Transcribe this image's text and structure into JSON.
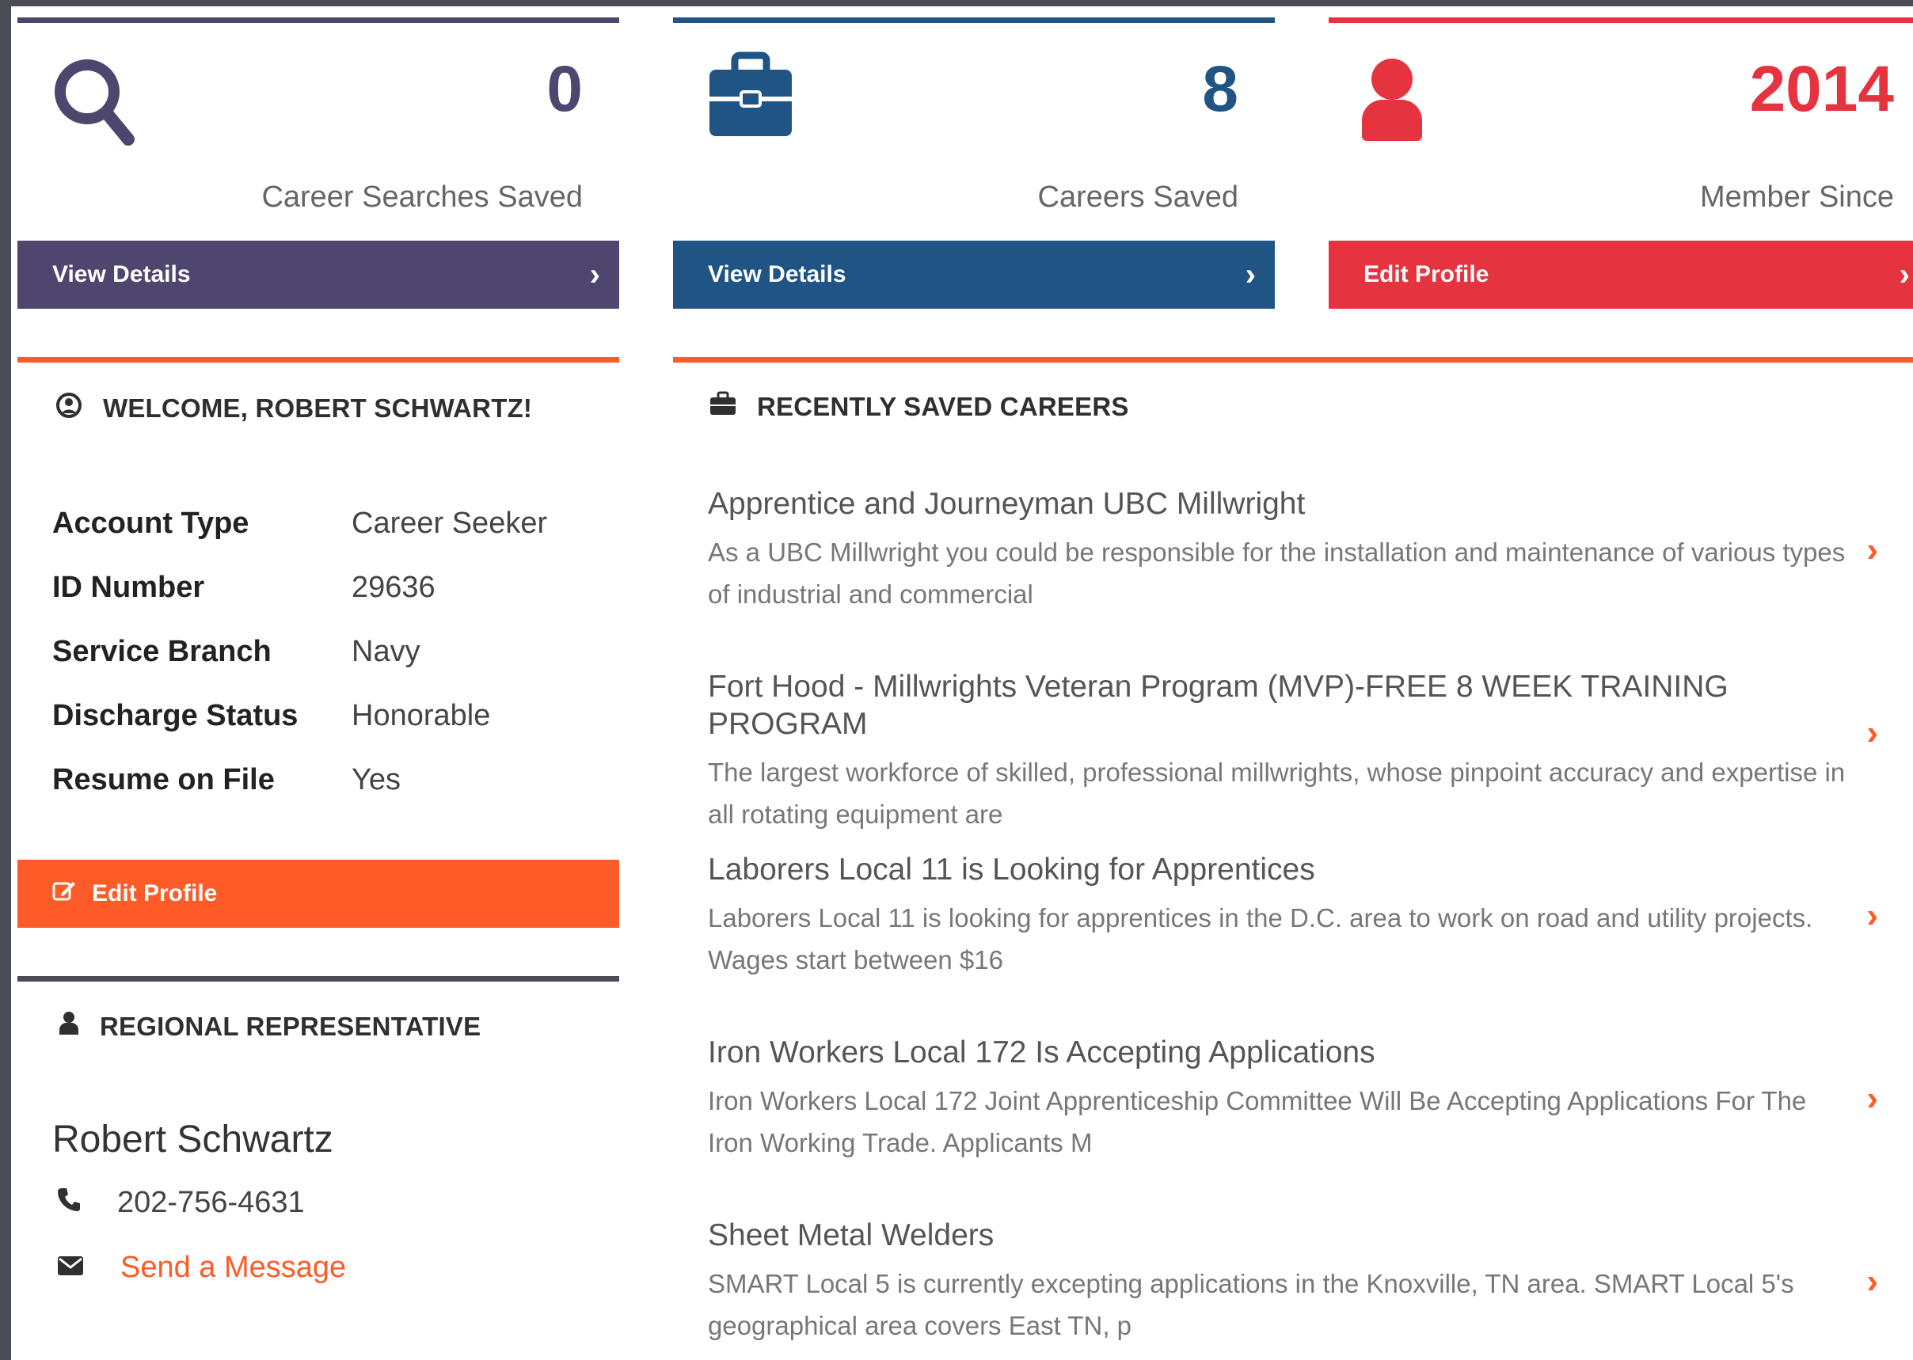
{
  "colors": {
    "purple": "#4f4670",
    "blue": "#205485",
    "red": "#e5333f",
    "orange": "#fd5b27",
    "dark_line": "#4a4d55"
  },
  "stats": [
    {
      "icon": "search-icon",
      "count": "0",
      "label": "Career Searches Saved",
      "button_label": "View Details"
    },
    {
      "icon": "briefcase-icon",
      "count": "8",
      "label": "Careers Saved",
      "button_label": "View Details"
    },
    {
      "icon": "user-icon",
      "count": "2014",
      "label": "Member Since",
      "button_label": "Edit Profile"
    }
  ],
  "welcome": {
    "title": "WELCOME, ROBERT SCHWARTZ!",
    "rows": [
      {
        "label": "Account Type",
        "value": "Career Seeker"
      },
      {
        "label": "ID Number",
        "value": "29636"
      },
      {
        "label": "Service Branch",
        "value": "Navy"
      },
      {
        "label": "Discharge Status",
        "value": "Honorable"
      },
      {
        "label": "Resume on File",
        "value": "Yes"
      }
    ],
    "edit_button": "Edit Profile"
  },
  "representative": {
    "title": "REGIONAL REPRESENTATIVE",
    "name": "Robert Schwartz",
    "phone": "202-756-4631",
    "message_link": "Send a Message"
  },
  "careers": {
    "title": "RECENTLY SAVED CAREERS",
    "items": [
      {
        "title": "Apprentice and Journeyman UBC Millwright",
        "desc": "As a UBC Millwright you could be responsible for the installation and maintenance of various types of industrial and commercial"
      },
      {
        "title": "Fort Hood - Millwrights Veteran Program (MVP)-FREE 8 WEEK TRAINING PROGRAM",
        "desc": "The largest workforce of skilled, professional millwrights, whose pinpoint accuracy and expertise in all rotating equipment are"
      },
      {
        "title": "Laborers Local 11 is Looking for Apprentices",
        "desc": "Laborers Local 11 is looking for apprentices in the D.C. area to work on road and utility projects. Wages start between $16"
      },
      {
        "title": "Iron Workers Local 172 Is Accepting Applications",
        "desc": "Iron Workers Local 172 Joint Apprenticeship Committee Will Be Accepting Applications For The Iron Working Trade. Applicants M"
      },
      {
        "title": "Sheet Metal Welders",
        "desc": "SMART Local 5 is currently excepting applications in the Knoxville, TN area. SMART Local 5's geographical area covers East TN, p"
      }
    ]
  }
}
